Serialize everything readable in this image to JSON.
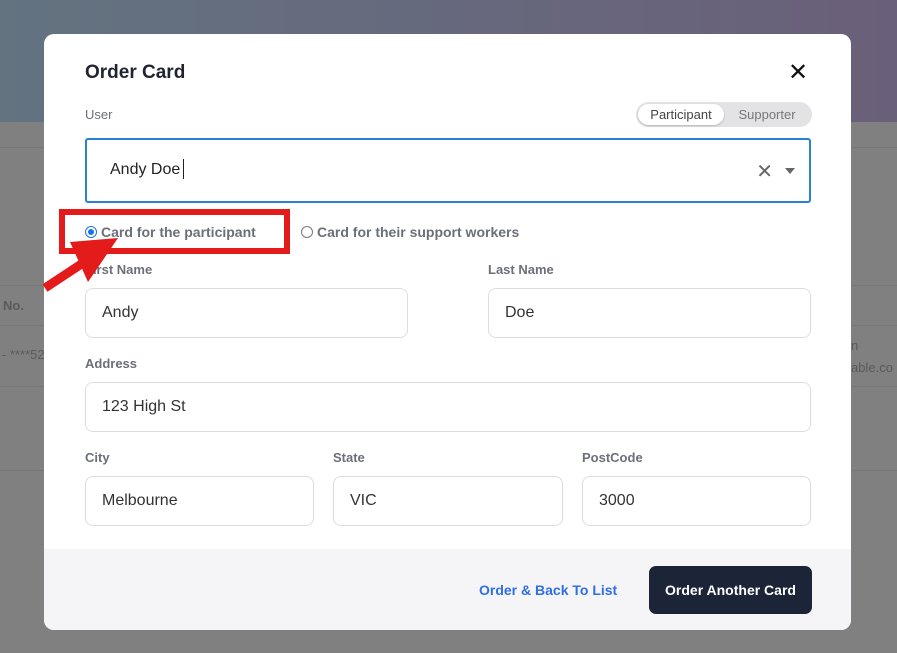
{
  "background": {
    "col_header": "No.",
    "cell1": "- ****52",
    "cell2": "n",
    "cell3": "able.co"
  },
  "modal": {
    "title": "Order Card",
    "close_icon": "close-icon",
    "user_label": "User",
    "toggle": [
      "Participant",
      "Supporter"
    ],
    "toggle_selected": "Participant",
    "user_value": "Andy Doe",
    "radios": [
      {
        "label": "Card for the participant",
        "checked": true
      },
      {
        "label": "Card for their support workers",
        "checked": false
      }
    ],
    "fields": {
      "first_name": {
        "label": "First Name",
        "value": "Andy"
      },
      "last_name": {
        "label": "Last Name",
        "value": "Doe"
      },
      "address": {
        "label": "Address",
        "value": "123 High St"
      },
      "city": {
        "label": "City",
        "value": "Melbourne"
      },
      "state": {
        "label": "State",
        "value": "VIC"
      },
      "postcode": {
        "label": "PostCode",
        "value": "3000"
      }
    },
    "footer": {
      "link": "Order & Back To List",
      "button": "Order Another Card"
    }
  },
  "colors": {
    "accent": "#2b7fd4",
    "annotation": "#e31b1b",
    "primary_button": "#1b2537",
    "link": "#2f6fe4"
  }
}
